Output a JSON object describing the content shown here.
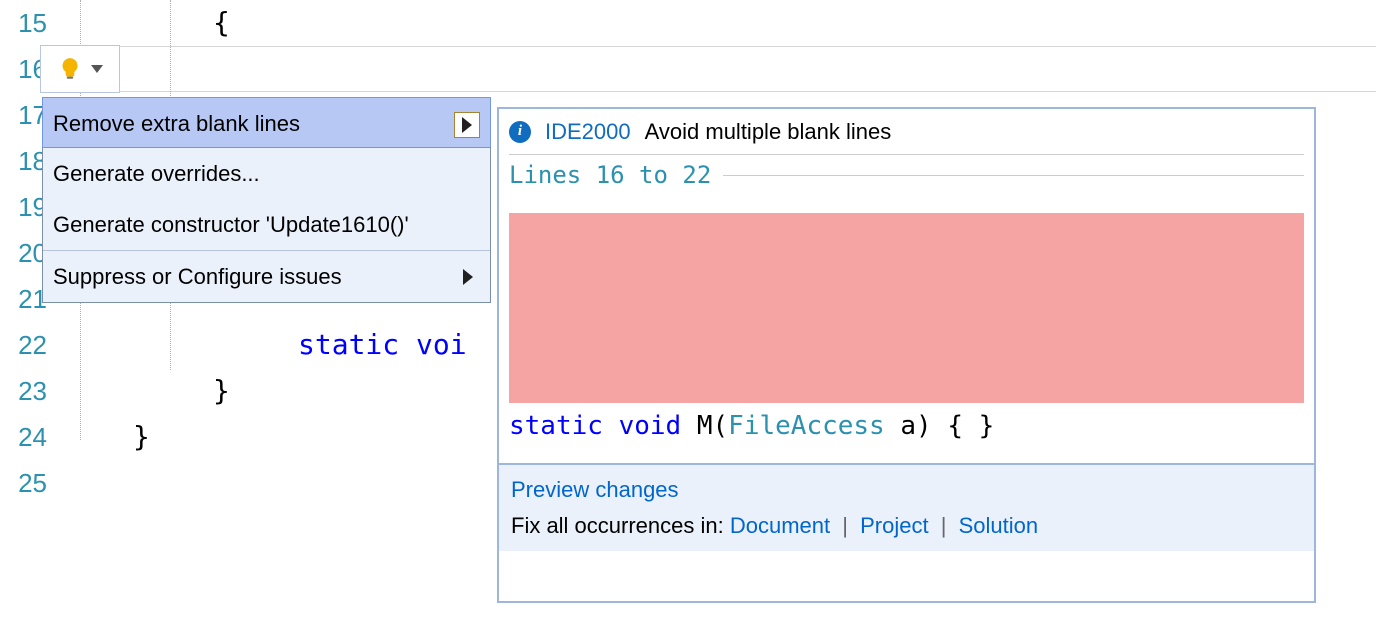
{
  "gutter": {
    "start": 15,
    "end": 25
  },
  "code": {
    "line15_brace": "{",
    "line22_static": "static",
    "line22_void": " voi",
    "line23_brace": "}",
    "line24_brace": "}"
  },
  "quickActions": {
    "items": [
      {
        "label": "Remove extra blank lines",
        "submenu": true,
        "selected": true
      },
      {
        "label": "Generate overrides...",
        "submenu": false
      },
      {
        "label": "Generate constructor 'Update1610()'",
        "submenu": false
      },
      {
        "label": "Suppress or Configure issues",
        "submenu": true
      }
    ]
  },
  "preview": {
    "ruleId": "IDE2000",
    "ruleDesc": "Avoid multiple blank lines",
    "linesHeader": "Lines 16 to 22",
    "codeLine": {
      "kw1": "static",
      "kw2": "void",
      "method": " M(",
      "type": "FileAccess",
      "rest": " a) { }"
    },
    "previewChanges": "Preview changes",
    "fixLabel": "Fix all occurrences in: ",
    "fixDocument": "Document",
    "fixProject": "Project",
    "fixSolution": "Solution"
  }
}
